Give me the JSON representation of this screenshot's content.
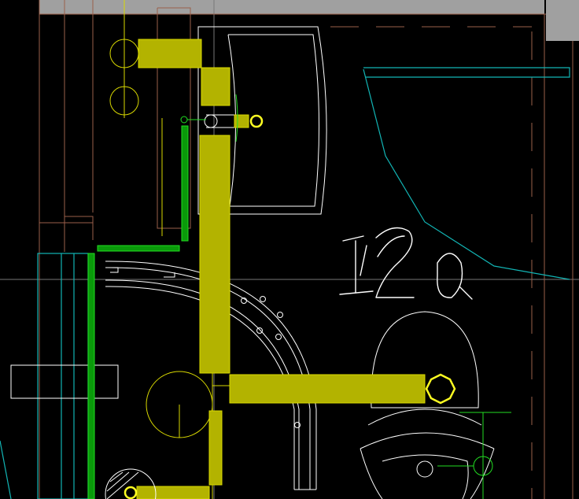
{
  "drawing": {
    "background_color": "#000000",
    "annotation": "120",
    "colors": {
      "wall": "#9a5f4a",
      "fixture_outline": "#ffffff",
      "pipe_fill": "#b3b300",
      "pipe_edge": "#d8d800",
      "green_pipe": "#22dd22",
      "cyan": "#12b5b5",
      "gray_block": "#a0a0a0"
    }
  }
}
